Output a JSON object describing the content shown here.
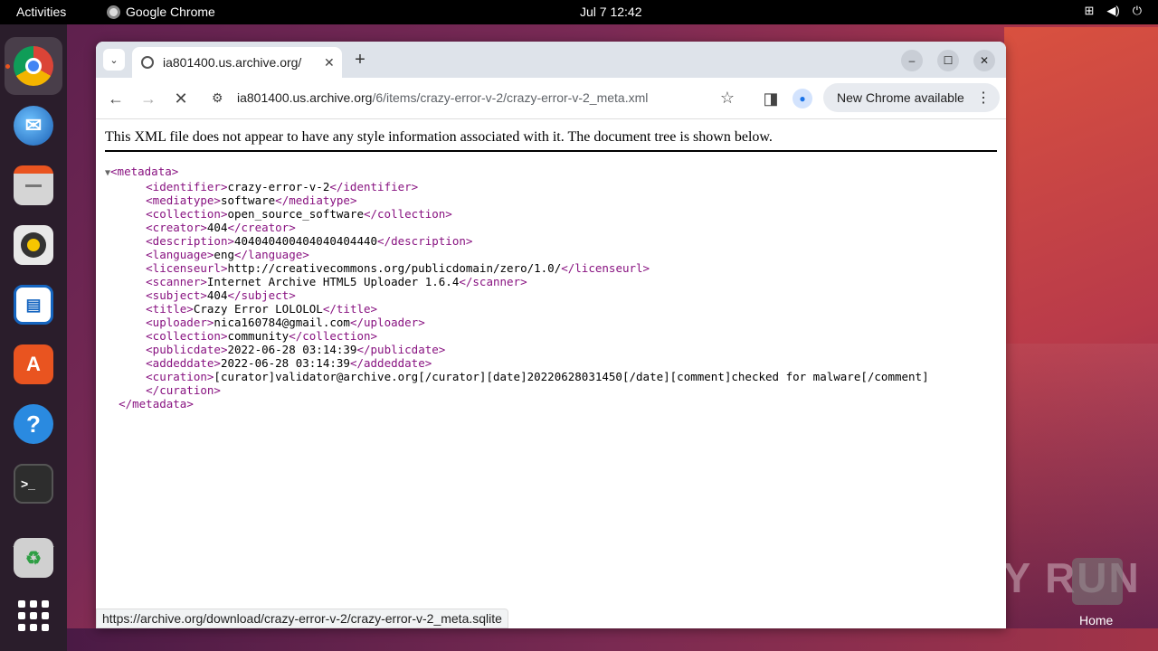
{
  "topbar": {
    "activities": "Activities",
    "app_name": "Google Chrome",
    "clock": "Jul 7  12:42"
  },
  "dock": {
    "items": [
      "chrome-icon",
      "thunderbird-icon",
      "files-icon",
      "rhythmbox-icon",
      "libreoffice-writer-icon",
      "app-center-icon",
      "help-icon",
      "terminal-icon",
      "trash-icon",
      "show-apps-icon"
    ]
  },
  "browser": {
    "tab_title": "ia801400.us.archive.org/",
    "url_host": "ia801400.us.archive.org",
    "url_path": "/6/items/crazy-error-v-2/crazy-error-v-2_meta.xml",
    "update_label": "New Chrome available",
    "status_url": "https://archive.org/download/crazy-error-v-2/crazy-error-v-2_meta.sqlite"
  },
  "page": {
    "xml_notice": "This XML file does not appear to have any style information associated with it. The document tree is shown below.",
    "xml": {
      "root": "metadata",
      "fields": [
        {
          "tag": "identifier",
          "value": "crazy-error-v-2"
        },
        {
          "tag": "mediatype",
          "value": "software"
        },
        {
          "tag": "collection",
          "value": "open_source_software"
        },
        {
          "tag": "creator",
          "value": "404"
        },
        {
          "tag": "description",
          "value": "404040400404040404440"
        },
        {
          "tag": "language",
          "value": "eng"
        },
        {
          "tag": "licenseurl",
          "value": "http://creativecommons.org/publicdomain/zero/1.0/"
        },
        {
          "tag": "scanner",
          "value": "Internet Archive HTML5 Uploader 1.6.4"
        },
        {
          "tag": "subject",
          "value": "404"
        },
        {
          "tag": "title",
          "value": "Crazy Error LOLOLOL"
        },
        {
          "tag": "uploader",
          "value": "nica160784@gmail.com"
        },
        {
          "tag": "collection",
          "value": "community"
        },
        {
          "tag": "publicdate",
          "value": "2022-06-28 03:14:39"
        },
        {
          "tag": "addeddate",
          "value": "2022-06-28 03:14:39"
        }
      ],
      "curation": "[curator]validator@archive.org[/curator][date]20220628031450[/date][comment]checked for malware[/comment]"
    }
  },
  "desktop": {
    "watermark": "ANY RUN",
    "home_label": "Home"
  }
}
